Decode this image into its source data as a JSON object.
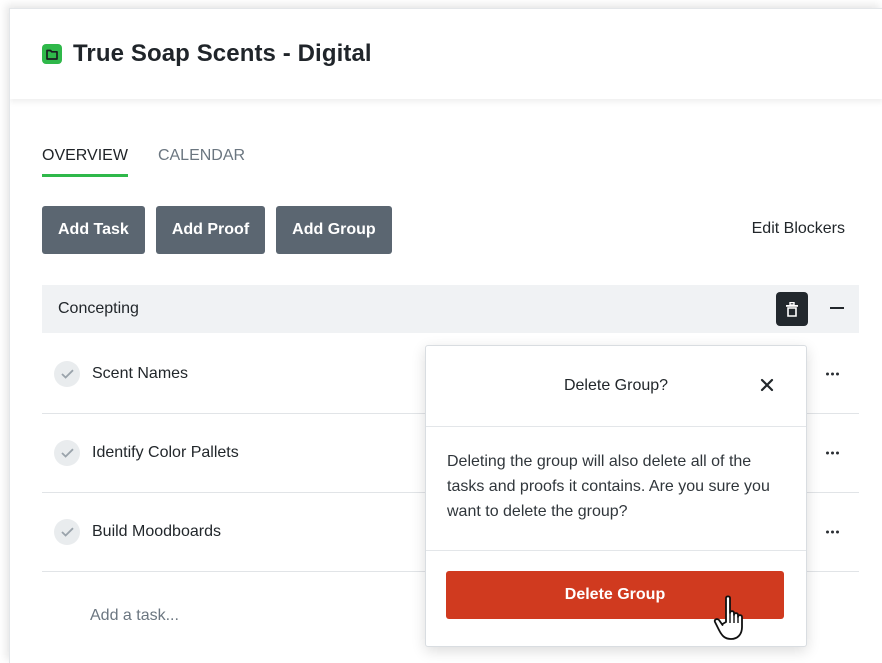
{
  "project": {
    "title": "True Soap Scents - Digital",
    "icon": "folder-icon",
    "icon_color": "#2fb84a"
  },
  "tabs": [
    {
      "label": "OVERVIEW",
      "active": true
    },
    {
      "label": "CALENDAR",
      "active": false
    }
  ],
  "toolbar": {
    "add_task_label": "Add Task",
    "add_proof_label": "Add Proof",
    "add_group_label": "Add Group",
    "edit_blockers_label": "Edit Blockers"
  },
  "group": {
    "name": "Concepting",
    "tasks": [
      {
        "label": "Scent Names",
        "icon": "checkmark-icon"
      },
      {
        "label": "Identify Color Pallets",
        "icon": "checkmark-icon"
      },
      {
        "label": "Build Moodboards",
        "icon": "checkmark-icon"
      }
    ],
    "add_task_placeholder": "Add a task..."
  },
  "dialog": {
    "title": "Delete Group?",
    "body": "Deleting the group will also delete all of the tasks and proofs it contains. Are you sure you want to delete the group?",
    "confirm_label": "Delete Group"
  },
  "colors": {
    "accent": "#2fb84a",
    "button_dark": "#5b6671",
    "danger": "#d03a1f"
  }
}
